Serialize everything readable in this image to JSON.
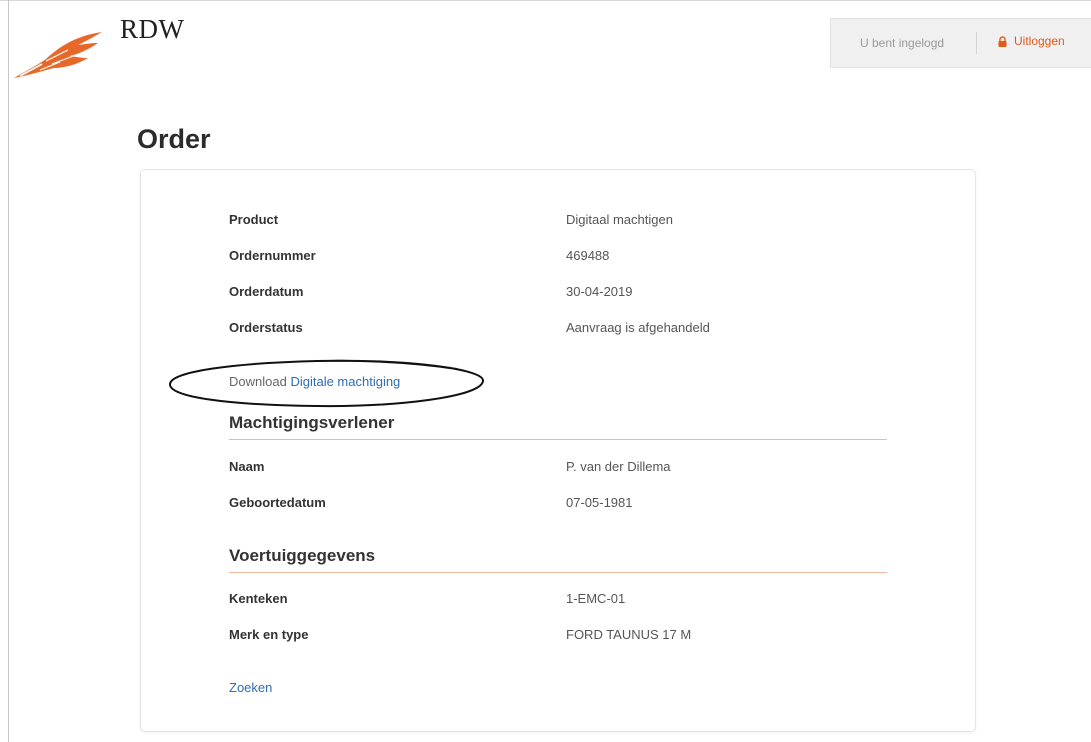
{
  "header": {
    "brand": "RDW",
    "login_status": "U bent ingelogd",
    "logout_label": "Uitloggen",
    "accent_color": "#e05a1a"
  },
  "page": {
    "title": "Order"
  },
  "order": {
    "rows": [
      {
        "label": "Product",
        "value": "Digitaal machtigen"
      },
      {
        "label": "Ordernummer",
        "value": "469488"
      },
      {
        "label": "Orderdatum",
        "value": "30-04-2019"
      },
      {
        "label": "Orderstatus",
        "value": "Aanvraag is afgehandeld"
      }
    ],
    "download_prefix": "Download",
    "download_link": "Digitale machtiging"
  },
  "grantor": {
    "title": "Machtigingsverlener",
    "rows": [
      {
        "label": "Naam",
        "value": "P. van der Dillema"
      },
      {
        "label": "Geboortedatum",
        "value": "07-05-1981"
      }
    ]
  },
  "vehicle": {
    "title": "Voertuiggegevens",
    "rows": [
      {
        "label": "Kenteken",
        "value": "1-EMC-01"
      },
      {
        "label": "Merk en type",
        "value": "FORD TAUNUS 17 M"
      }
    ]
  },
  "footer": {
    "search_link": "Zoeken"
  },
  "icons": {
    "logo": "rdw-feather-logo",
    "lock": "lock-icon",
    "annotation": "ellipse-annotation"
  }
}
